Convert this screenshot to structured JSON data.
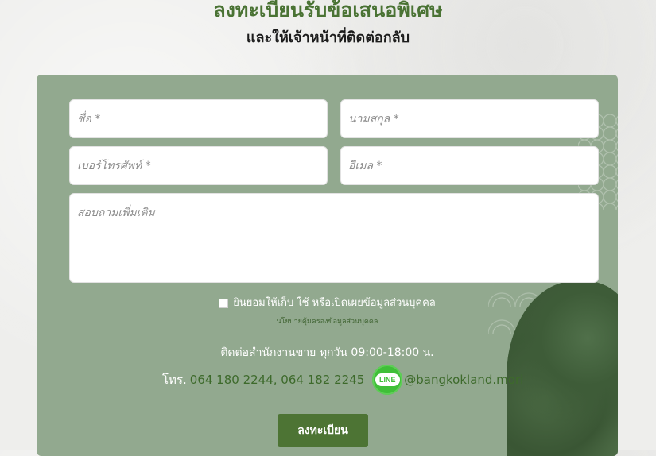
{
  "header": {
    "title": "ลงทะเบียนรับข้อเสนอพิเศษ",
    "subtitle": "และให้เจ้าหน้าที่ติดต่อกลับ"
  },
  "form": {
    "first_name_placeholder": "ชื่อ *",
    "last_name_placeholder": "นามสกุล *",
    "phone_placeholder": "เบอร์โทรศัพท์ *",
    "email_placeholder": "อีเมล *",
    "message_placeholder": "สอบถามเพิ่มเติม",
    "consent_label": "ยินยอมให้เก็บ ใช้ หรือเปิดเผยข้อมูลส่วนบุคคล",
    "policy_link": "นโยบายคุ้มครองข้อมูลส่วนบุคคล",
    "submit_label": "ลงทะเบียน"
  },
  "contact": {
    "hours": "ติดต่อสำนักงานขาย ทุกวัน 09:00-18:00 น.",
    "phone_prefix": "โทร.",
    "phones": "064 180 2244, 064 182 2245",
    "line_badge": "LINE",
    "line_id": "@bangkokland.mori"
  },
  "colors": {
    "accent": "#4a7334",
    "card_bg": "#92a98f",
    "button_bg": "#4d7434",
    "line_green": "#3fbf38"
  },
  "icons": [
    "line-icon",
    "checkbox-icon"
  ]
}
